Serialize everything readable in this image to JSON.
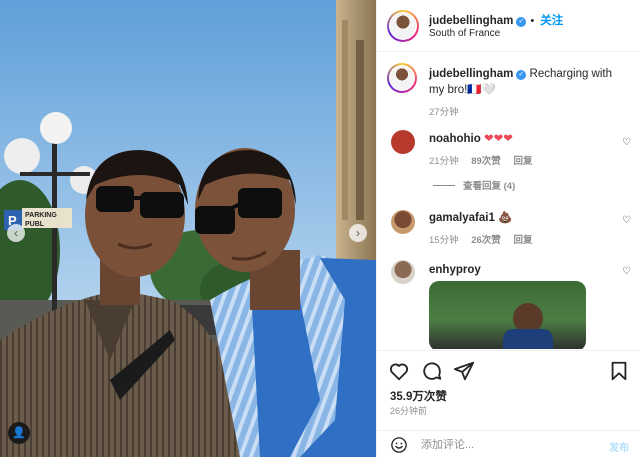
{
  "header": {
    "username": "judebellingham",
    "follow_label": "关注",
    "location": "South of France"
  },
  "caption": {
    "username": "judebellingham",
    "text": "Recharging with my bro!🇫🇷🤍",
    "time": "27分钟"
  },
  "photo": {
    "sign_parking": "PARKING",
    "sign_public": "PUBL",
    "sign_p": "P"
  },
  "comments": [
    {
      "username": "noahohio",
      "text": "❤❤❤",
      "time": "21分钟",
      "likes": "89次赞",
      "reply_label": "回复",
      "view_replies": "查看回复 (4)"
    },
    {
      "username": "gamalyafai1",
      "text": "💩",
      "time": "15分钟",
      "likes": "26次赞",
      "reply_label": "回复"
    },
    {
      "username": "enhyproy",
      "text": ""
    }
  ],
  "stats": {
    "likes": "35.9万次赞",
    "time_ago": "26分钟前"
  },
  "composer": {
    "placeholder": "添加评论...",
    "post_label": "发布"
  },
  "icons": {
    "verified": "verified-badge-icon",
    "like": "heart-outline-icon",
    "comment": "comment-bubble-icon",
    "share": "paper-plane-icon",
    "save": "bookmark-icon",
    "emoji": "smiley-icon"
  },
  "colors": {
    "link_blue": "#0095f6",
    "verified_blue": "#3897f0",
    "heart_red": "#ed4956",
    "muted_text": "#8e8e8e"
  }
}
